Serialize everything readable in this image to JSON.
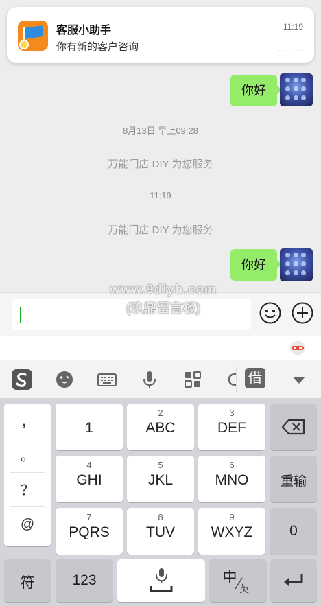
{
  "notification": {
    "title": "客服小助手",
    "time": "11:19",
    "body": "你有新的客户咨询"
  },
  "messages": {
    "msg1": "你好",
    "timestamp1": "8月13日 早上09:28",
    "system1": "万能门店 DIY 为您服务",
    "timestamp2": "11:19",
    "system2": "万能门店 DIY 为您服务",
    "msg2": "你好"
  },
  "watermark": {
    "line1": "www.9dlyb.com",
    "line2": "(玖鼎留言板)"
  },
  "input": {
    "value": ""
  },
  "toolbar": {
    "icons": [
      "sogou-logo-icon",
      "emoji-face-icon",
      "keyboard-icon",
      "microphone-icon",
      "apps-grid-icon",
      "clipboard-icon",
      "borrow-icon",
      "collapse-icon"
    ],
    "borrow_label": "借"
  },
  "keyboard": {
    "punctuation": [
      "，",
      "。",
      "？",
      "@"
    ],
    "keys": {
      "k1": {
        "num": "",
        "label": "1"
      },
      "k2": {
        "num": "2",
        "label": "ABC"
      },
      "k3": {
        "num": "3",
        "label": "DEF"
      },
      "k4": {
        "num": "4",
        "label": "GHI"
      },
      "k5": {
        "num": "5",
        "label": "JKL"
      },
      "k6": {
        "num": "6",
        "label": "MNO"
      },
      "k7": {
        "num": "7",
        "label": "PQRS"
      },
      "k8": {
        "num": "8",
        "label": "TUV"
      },
      "k9": {
        "num": "9",
        "label": "WXYZ"
      }
    },
    "reinput": "重输",
    "zero": "0",
    "symbols": "符",
    "numbers": "123",
    "lang_main": "中",
    "lang_alt": "英"
  },
  "colors": {
    "bubble": "#95ec69",
    "accent": "#1aad19",
    "notification_icon": "#f28a1c"
  }
}
